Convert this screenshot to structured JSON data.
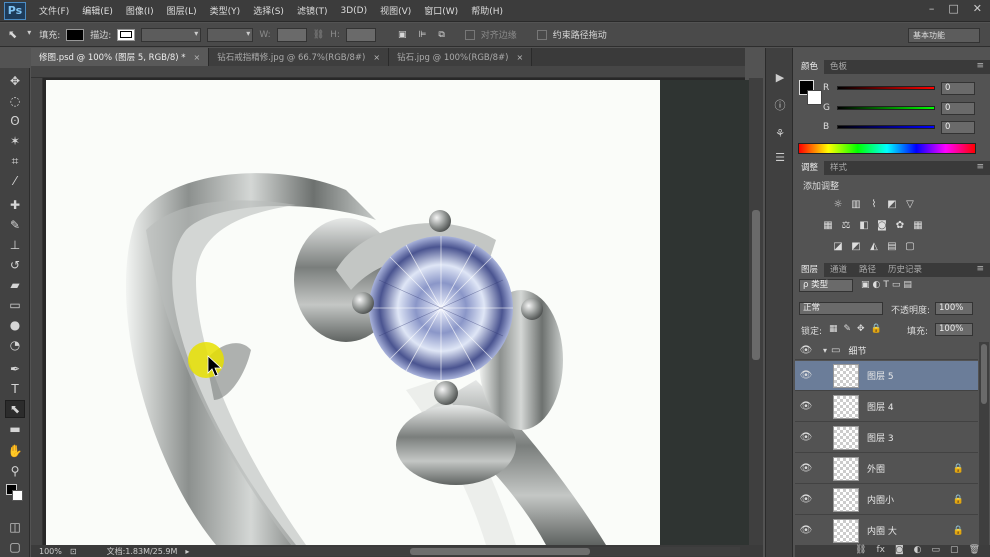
{
  "app": {
    "logo": "Ps"
  },
  "menu": [
    "文件(F)",
    "编辑(E)",
    "图像(I)",
    "图层(L)",
    "类型(Y)",
    "选择(S)",
    "滤镜(T)",
    "3D(D)",
    "视图(V)",
    "窗口(W)",
    "帮助(H)"
  ],
  "options": {
    "fill_label": "填充:",
    "stroke_label": "描边:",
    "w_label": "W:",
    "h_label": "H:",
    "align_edges": "对齐边缘",
    "constrain_path": "约束路径拖动",
    "workspace": "基本功能"
  },
  "tabs": [
    {
      "label": "修图.psd @ 100% (图层 5, RGB/8) *",
      "active": true
    },
    {
      "label": "钻石戒指精修.jpg @ 66.7%(RGB/8#)",
      "active": false
    },
    {
      "label": "钻石.jpg @ 100%(RGB/8#)",
      "active": false
    }
  ],
  "status": {
    "zoom": "100%",
    "doc": "文档:1.83M/25.9M"
  },
  "color_panel": {
    "tabs": [
      "颜色",
      "色板"
    ],
    "sliders": [
      {
        "label": "R",
        "value": "0"
      },
      {
        "label": "G",
        "value": "0"
      },
      {
        "label": "B",
        "value": "0"
      }
    ]
  },
  "adjust_panel": {
    "tabs": [
      "调整",
      "样式"
    ],
    "title": "添加调整"
  },
  "layers_panel": {
    "tabs": [
      "图层",
      "通道",
      "路径",
      "历史记录"
    ],
    "filter": "ρ 类型",
    "blend_mode": "正常",
    "opacity_label": "不透明度:",
    "opacity": "100%",
    "lock_label": "锁定:",
    "fill_label": "填充:",
    "fill": "100%",
    "group": "细节",
    "layers": [
      {
        "name": "图层 5",
        "selected": true,
        "locked": false
      },
      {
        "name": "图层 4",
        "selected": false,
        "locked": false
      },
      {
        "name": "图层 3",
        "selected": false,
        "locked": false
      },
      {
        "name": "外圈",
        "selected": false,
        "locked": true
      },
      {
        "name": "内圈小",
        "selected": false,
        "locked": true
      },
      {
        "name": "内圈 大",
        "selected": false,
        "locked": true
      }
    ]
  },
  "colors": {
    "selected_layer": "#6b7d99",
    "canvas_bg": "#fafcf9",
    "cursor_highlight": "#e6e000"
  }
}
